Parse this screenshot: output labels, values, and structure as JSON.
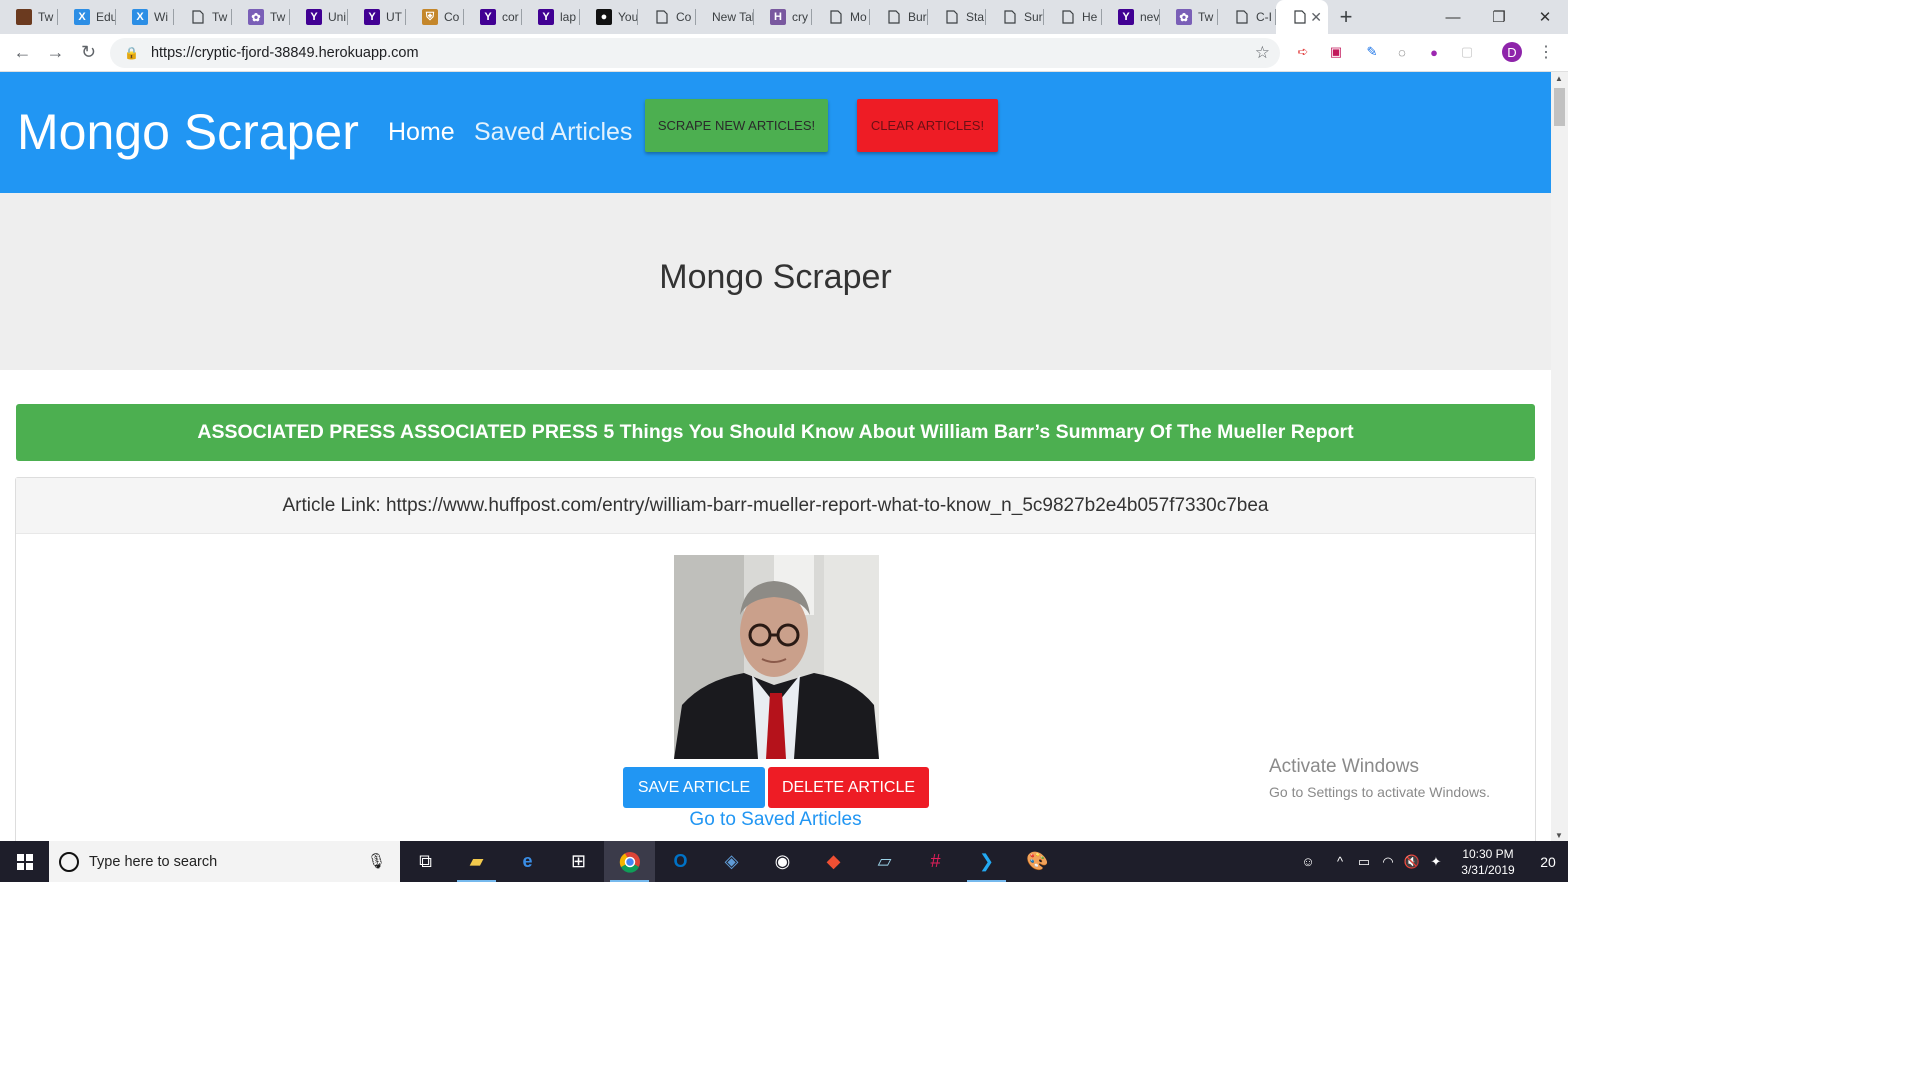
{
  "browser": {
    "tabs": [
      {
        "title": "Tw",
        "icon": "brown-square-icon",
        "color": "#6b3a1f"
      },
      {
        "title": "Edu",
        "icon": "x-logo-icon",
        "color": "#2c8ee5"
      },
      {
        "title": "Wi",
        "icon": "x-logo-icon",
        "color": "#2c8ee5"
      },
      {
        "title": "Tw",
        "icon": "page-icon",
        "color": "#ffffff"
      },
      {
        "title": "Tw",
        "icon": "twitch-icon",
        "color": "#7a5fb7"
      },
      {
        "title": "Uni",
        "icon": "yahoo-icon",
        "color": "#410093"
      },
      {
        "title": "UT",
        "icon": "yahoo-icon",
        "color": "#410093"
      },
      {
        "title": "Co",
        "icon": "shield-icon",
        "color": "#c4862a"
      },
      {
        "title": "cor",
        "icon": "yahoo-icon",
        "color": "#410093"
      },
      {
        "title": "lap",
        "icon": "yahoo-icon",
        "color": "#410093"
      },
      {
        "title": "You",
        "icon": "github-icon",
        "color": "#111111"
      },
      {
        "title": "Co",
        "icon": "page-icon",
        "color": "#ffffff"
      },
      {
        "title": "New Tal",
        "icon": "none",
        "color": "#ffffff"
      },
      {
        "title": "cry",
        "icon": "heroku-icon",
        "color": "#79589f"
      },
      {
        "title": "Mo",
        "icon": "page-icon",
        "color": "#ffffff"
      },
      {
        "title": "Bur",
        "icon": "page-icon",
        "color": "#ffffff"
      },
      {
        "title": "Sta",
        "icon": "page-icon",
        "color": "#ffffff"
      },
      {
        "title": "Sur",
        "icon": "page-icon",
        "color": "#ffffff"
      },
      {
        "title": "He",
        "icon": "page-icon",
        "color": "#ffffff"
      },
      {
        "title": "nev",
        "icon": "yahoo-icon",
        "color": "#410093"
      },
      {
        "title": "Tw",
        "icon": "twitch-icon",
        "color": "#7a5fb7"
      },
      {
        "title": "C-I",
        "icon": "page-icon",
        "color": "#ffffff"
      }
    ],
    "url": "https://cryptic-fjord-38849.herokuapp.com"
  },
  "page": {
    "brand": "Mongo Scraper",
    "nav_home": "Home",
    "nav_saved": "Saved Articles",
    "scrape_button": "SCRAPE NEW ARTICLES!",
    "clear_button": "CLEAR ARTICLES!",
    "jumbotron_title": "Mongo Scraper",
    "article": {
      "headline": "ASSOCIATED PRESS ASSOCIATED PRESS 5 Things You Should Know About William Barr’s Summary Of The Mueller Report",
      "link_text": "Article Link: https://www.huffpost.com/entry/william-barr-mueller-report-what-to-know_n_5c9827b2e4b057f7330c7bea",
      "save_button": "SAVE ARTICLE",
      "delete_button": "DELETE ARTICLE",
      "goto_saved": "Go to Saved Articles"
    },
    "colors": {
      "primary": "#2196f3",
      "success": "#4caf50",
      "danger": "#ee1c25"
    }
  },
  "watermark": {
    "line1": "Activate Windows",
    "line2": "Go to Settings to activate Windows."
  },
  "taskbar": {
    "search_placeholder": "Type here to search",
    "time": "10:30 PM",
    "date": "3/31/2019",
    "notification_count": "20"
  }
}
